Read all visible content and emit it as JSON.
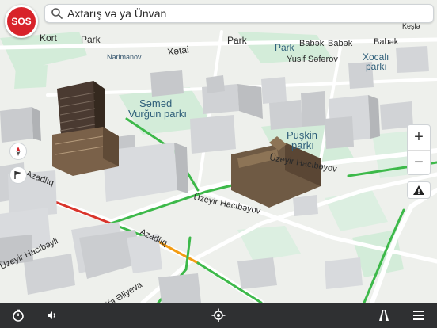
{
  "search": {
    "placeholder": "Axtarış və ya Ünvan"
  },
  "sos": {
    "label": "SOS"
  },
  "zoom": {
    "in_label": "+",
    "out_label": "−"
  },
  "map": {
    "labels": [
      {
        "text": "Kort"
      },
      {
        "text": "Park"
      },
      {
        "text": "Park"
      },
      {
        "text": "Babək"
      },
      {
        "text": "Babək"
      },
      {
        "text": "Babək"
      },
      {
        "text": "Keşlə"
      },
      {
        "text": "Nərimanov"
      },
      {
        "text": "Xətai"
      },
      {
        "text": "Park"
      },
      {
        "text": "Yusif Səfərov"
      },
      {
        "text": "Xocalı"
      },
      {
        "text": "parkı"
      },
      {
        "text": "Səməd"
      },
      {
        "text": "Vurğun parkı"
      },
      {
        "text": "Puşkin"
      },
      {
        "text": "parkı"
      },
      {
        "text": "Üzeyir Hacıbəyov"
      },
      {
        "text": "Üzeyir Hacıbəyov"
      },
      {
        "text": "Azadlıq"
      },
      {
        "text": "Azadlıq"
      },
      {
        "text": "Üzeyir Hacıbəyli"
      },
      {
        "text": "Zərifə Əliyeva"
      }
    ]
  },
  "colors": {
    "sos": "#d8232a",
    "traffic_green": "#3db94a",
    "traffic_orange": "#f39c12",
    "traffic_red": "#d9342b",
    "bar": "#2f3032"
  },
  "icons": {
    "bottom": [
      "timer-icon",
      "volume-icon",
      "locate-icon",
      "route-icon",
      "menu-icon"
    ],
    "map_left": [
      "compass-icon",
      "flag-icon"
    ]
  }
}
